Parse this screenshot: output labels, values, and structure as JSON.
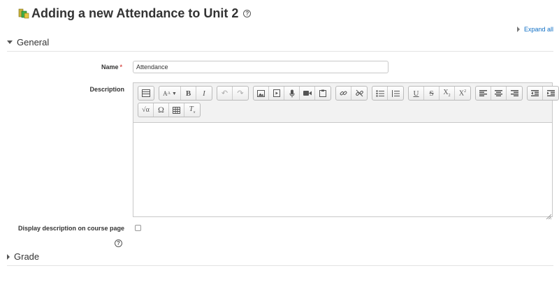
{
  "page": {
    "title": "Adding a new Attendance to Unit 2",
    "module_icon": "attendance-icon",
    "help_icon": "help-icon",
    "expand_all": "Expand all"
  },
  "sections": {
    "general": {
      "label": "General",
      "state": "expanded"
    },
    "grade": {
      "label": "Grade",
      "state": "collapsed"
    }
  },
  "form": {
    "name_label": "Name",
    "required_marker": "*",
    "name_value": "Attendance",
    "description_label": "Description",
    "description_value": "",
    "display_description_label": "Display description on course page",
    "display_description_checked": false
  },
  "editor_toolbar": {
    "row1": [
      [
        "collapse-toolbar"
      ],
      [
        "paragraph-styles",
        "bold",
        "italic"
      ],
      [
        "undo",
        "redo"
      ],
      [
        "insert-image",
        "insert-media",
        "record-audio",
        "record-video",
        "manage-files"
      ],
      [
        "link",
        "unlink"
      ],
      [
        "unordered-list",
        "ordered-list"
      ],
      [
        "underline",
        "strikethrough",
        "subscript",
        "superscript"
      ],
      [
        "align-left",
        "align-center",
        "align-right"
      ],
      [
        "outdent",
        "indent"
      ]
    ],
    "row2": [
      [
        "equation",
        "special-character",
        "table",
        "clear-formatting"
      ]
    ]
  },
  "colors": {
    "link": "#0f6fc5",
    "required": "#d9534f",
    "border": "#c8c8c8",
    "toolbar_bg": "#f2f2f2"
  }
}
